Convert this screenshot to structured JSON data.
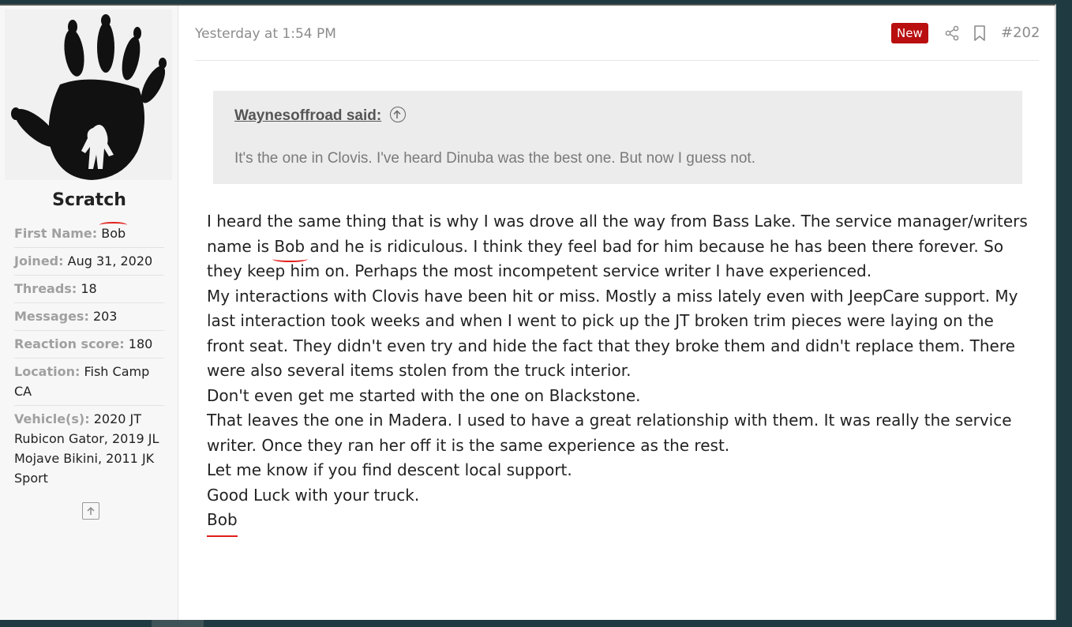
{
  "author": {
    "username": "Scratch",
    "fields": [
      {
        "label": "First Name:",
        "value": "Bob"
      },
      {
        "label": "Joined:",
        "value": "Aug 31, 2020"
      },
      {
        "label": "Threads:",
        "value": "18"
      },
      {
        "label": "Messages:",
        "value": "203"
      },
      {
        "label": "Reaction score:",
        "value": "180"
      },
      {
        "label": "Location:",
        "value": "Fish Camp CA"
      },
      {
        "label": "Vehicle(s):",
        "value": "2020 JT Rubicon Gator, 2019 JL Mojave Bikini, 2011 JK Sport"
      }
    ]
  },
  "header": {
    "timestamp": "Yesterday at 1:54 PM",
    "badge": "New",
    "post_number": "#202",
    "share_icon": "share-icon",
    "bookmark_icon": "bookmark-icon"
  },
  "quote": {
    "author": "Waynesoffroad said:",
    "text": "It's the one in Clovis. I've heard Dinuba was the best one. But now I guess not."
  },
  "body": {
    "p1_a": "I heard the same thing that is why I was drove all the way from Bass Lake. The service manager/writers name is ",
    "p1_bob": "Bob",
    "p1_b": " and he is ridiculous. I think they feel bad for him because he has been there forever. So they keep him on. Perhaps the most incompetent service writer I have experienced.",
    "p2": "My interactions with Clovis have been hit or miss. Mostly a miss lately even with JeepCare support. My last interaction took weeks and when I went to pick up the JT broken trim pieces were laying on the front seat. They didn't even try and hide the fact that they broke them and didn't replace them. There were also several items stolen from the truck interior.",
    "p3": "Don't even get me started with the one on Blackstone.",
    "p4": "That leaves the one in Madera. I used to have a great relationship with them. It was really the service writer. Once they ran her off it is the same experience as the rest.",
    "p5": "Let me know if you find descent local support.",
    "p6": "Good Luck with your truck.",
    "signature": "Bob"
  },
  "colors": {
    "badge": "#b90f0f",
    "annotation": "#e0201c",
    "quote_bg": "#ececec"
  }
}
